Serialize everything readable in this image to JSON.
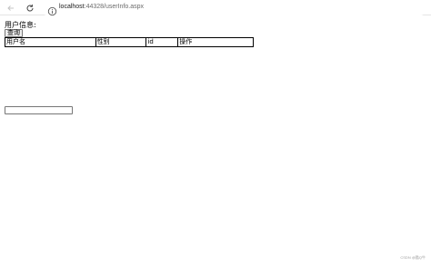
{
  "browser": {
    "url_host": "localhost",
    "url_rest": ":44328/userInfo.aspx"
  },
  "page": {
    "info_label": "用户信息:",
    "query_button": "查询",
    "table_headers": [
      "用户名",
      "性别",
      "id",
      "操作"
    ],
    "input_value": ""
  },
  "watermark": "CSDN @酷Q牛"
}
